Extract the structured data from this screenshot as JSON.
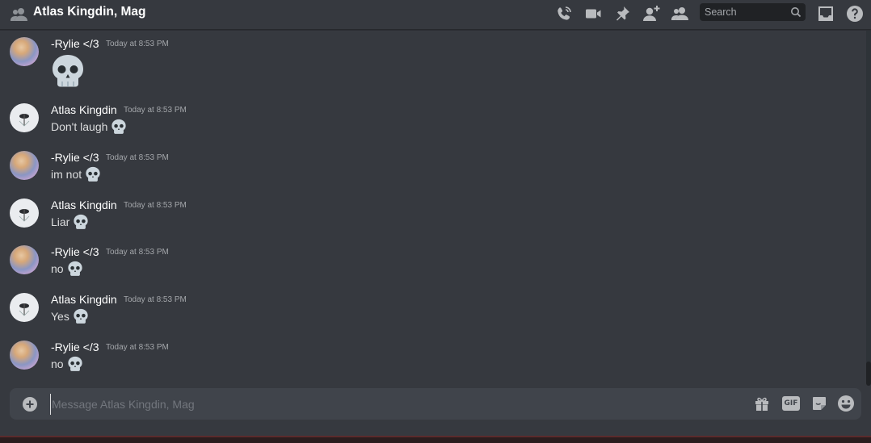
{
  "header": {
    "channel_title": "Atlas Kingdin, Mag",
    "icons": [
      "people-icon",
      "phone-call-icon",
      "video-call-icon",
      "pin-icon",
      "add-friend-icon",
      "members-icon",
      "inbox-icon",
      "help-icon"
    ],
    "search_placeholder": "Search"
  },
  "messages": [
    {
      "author": "-Rylie </3",
      "timestamp": "Today at 8:53 PM",
      "text": "",
      "emoji": "skull",
      "big": true
    },
    {
      "author": "Atlas Kingdin",
      "timestamp": "Today at 8:53 PM",
      "text": "Don't laugh",
      "emoji": "skull"
    },
    {
      "author": "-Rylie </3",
      "timestamp": "Today at 8:53 PM",
      "text": "im not",
      "emoji": "skull"
    },
    {
      "author": "Atlas Kingdin",
      "timestamp": "Today at 8:53 PM",
      "text": "Liar",
      "emoji": "skull"
    },
    {
      "author": "-Rylie </3",
      "timestamp": "Today at 8:53 PM",
      "text": "no",
      "emoji": "skull"
    },
    {
      "author": "Atlas Kingdin",
      "timestamp": "Today at 8:53 PM",
      "text": "Yes",
      "emoji": "skull"
    },
    {
      "author": "-Rylie </3",
      "timestamp": "Today at 8:53 PM",
      "text": "no",
      "emoji": "skull"
    }
  ],
  "composer": {
    "placeholder": "Message Atlas Kingdin, Mag",
    "gif_label": "GIF",
    "icons": [
      "plus-icon",
      "gift-icon",
      "gif-icon",
      "sticker-icon",
      "emoji-icon"
    ]
  },
  "colors": {
    "background": "#36393f",
    "input_bg": "#40444b",
    "search_bg": "#202225",
    "icon": "#b9bbbe",
    "muted_text": "#72767d"
  }
}
